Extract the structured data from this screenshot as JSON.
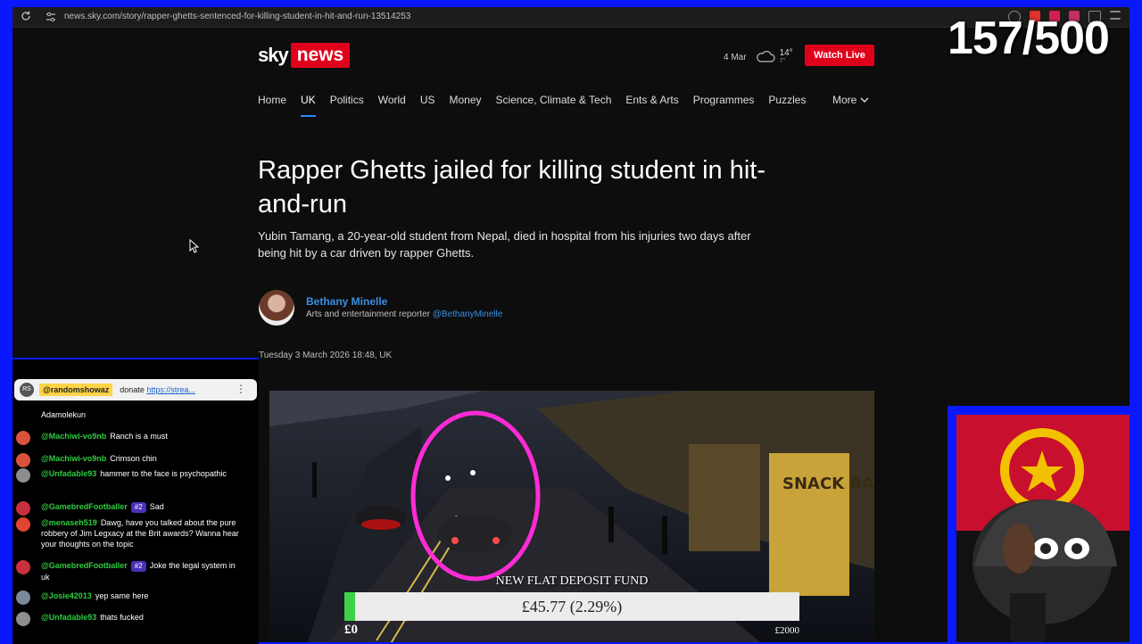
{
  "browser": {
    "url": "news.sky.com/story/rapper-ghetts-sentenced-for-killing-student-in-hit-and-run-13514253"
  },
  "site": {
    "logo_sky": "sky",
    "logo_news": "news",
    "weather": {
      "date": "4 Mar",
      "high": "14°",
      "low": "7°",
      "icon": "cloud-icon"
    },
    "watch_live": "Watch Live",
    "nav": [
      "Home",
      "UK",
      "Politics",
      "World",
      "US",
      "Money",
      "Science, Climate & Tech",
      "Ents & Arts",
      "Programmes",
      "Puzzles"
    ],
    "nav_active": "UK",
    "nav_more": "More",
    "accent": "#e0001b",
    "link_color": "#3b8fe0"
  },
  "article": {
    "headline": "Rapper Ghetts jailed for killing student in hit-and-run",
    "standfirst": "Yubin Tamang, a 20-year-old student from Nepal, died in hospital from his injuries two days after being hit by a car driven by rapper Ghetts.",
    "author": {
      "name": "Bethany Minelle",
      "role": "Arts and entertainment reporter",
      "handle": "@BethanyMinelle"
    },
    "date": "Tuesday 3 March 2026 18:48, UK"
  },
  "video_sign": "SNACK BAR",
  "overlay": {
    "counter": "157/500"
  },
  "chat": {
    "pinned": {
      "avatar": "RS",
      "user": "@randomshowaz",
      "text": "donate",
      "link": "https://strea..."
    },
    "messages": [
      {
        "user": "",
        "text": "Adamolekun",
        "avatar_color": "#000000"
      },
      {
        "user": "@Machiwi-vo9nb",
        "text": "Ranch is a must",
        "badge": "",
        "avatar_color": "#d9533c"
      },
      {
        "user": "@Machiwi-vo9nb",
        "text": "Crimson chin",
        "badge": "",
        "avatar_color": "#d9533c"
      },
      {
        "user": "@Unfadable93",
        "text": "hammer to the face is psychopathic",
        "badge": "",
        "avatar_color": "#8d8d8d"
      },
      {
        "user": "@GamebredFootballer",
        "text": "Sad",
        "badge": "#2",
        "avatar_color": "#c9303e"
      },
      {
        "user": "@menaseh519",
        "text": "Dawg, have you talked about the pure robbery of Jim Legxacy at the Brit awards? Wanna hear your thoughts on the topic",
        "badge": "",
        "avatar_color": "#e3442f"
      },
      {
        "user": "@GamebredFootballer",
        "text": "Joke the legal system in uk",
        "badge": "#2",
        "avatar_color": "#c9303e"
      },
      {
        "user": "@Josie42013",
        "text": "yep same here",
        "badge": "",
        "avatar_color": "#7a8a9a"
      },
      {
        "user": "@Unfadable93",
        "text": "thats fucked",
        "badge": "",
        "avatar_color": "#8d8d8d"
      }
    ]
  },
  "fund": {
    "title": "NEW FLAT DEPOSIT FUND",
    "amount": "£45.77 (2.29%)",
    "progress": 0.0229,
    "min": "£0",
    "max": "£2000"
  }
}
